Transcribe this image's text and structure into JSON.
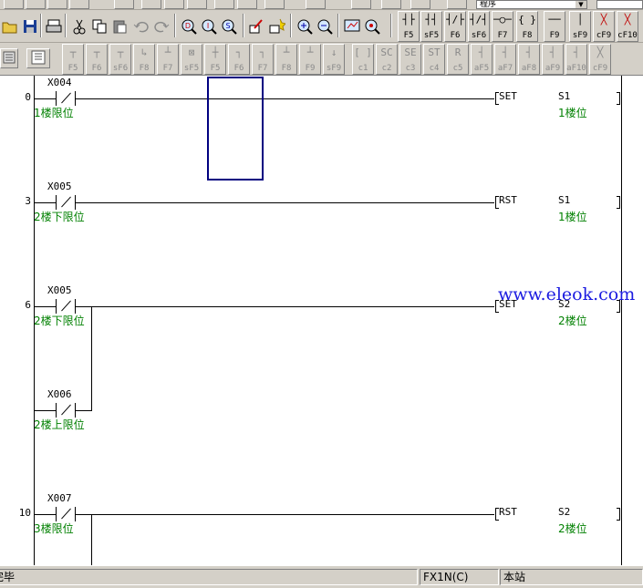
{
  "toolbar_top": {
    "program_combo_value": "程序"
  },
  "toolbar_main": {
    "ladder_keys": [
      {
        "key": "F5",
        "glyph": "┤├"
      },
      {
        "key": "sF5",
        "glyph": "┤┤"
      },
      {
        "key": "F6",
        "glyph": "┤/├"
      },
      {
        "key": "sF6",
        "glyph": "┤/┤"
      },
      {
        "key": "F7",
        "glyph": "─○─"
      },
      {
        "key": "F8",
        "glyph": "{ }"
      },
      {
        "key": "F9",
        "glyph": "──"
      },
      {
        "key": "sF9",
        "glyph": "│"
      },
      {
        "key": "cF9",
        "glyph": "╳"
      },
      {
        "key": "cF10",
        "glyph": "╳"
      }
    ]
  },
  "toolbar_secondary": {
    "ladder_keys": [
      {
        "key": "F5",
        "glyph": "┬"
      },
      {
        "key": "F6",
        "glyph": "┬"
      },
      {
        "key": "sF6",
        "glyph": "┬"
      },
      {
        "key": "F8",
        "glyph": "↳"
      },
      {
        "key": "F7",
        "glyph": "┴"
      },
      {
        "key": "sF5",
        "glyph": "⊠"
      },
      {
        "key": "F5",
        "glyph": "┼"
      },
      {
        "key": "F6",
        "glyph": "┐"
      },
      {
        "key": "F7",
        "glyph": "┐"
      },
      {
        "key": "F8",
        "glyph": "┴"
      },
      {
        "key": "F9",
        "glyph": "┴"
      },
      {
        "key": "sF9",
        "glyph": "↓"
      },
      {
        "key": "c1",
        "glyph": "[ ]"
      },
      {
        "key": "c2",
        "glyph": "SC"
      },
      {
        "key": "c3",
        "glyph": "SE"
      },
      {
        "key": "c4",
        "glyph": "ST"
      },
      {
        "key": "c5",
        "glyph": "R"
      },
      {
        "key": "aF5",
        "glyph": "┤"
      },
      {
        "key": "aF7",
        "glyph": "┤"
      },
      {
        "key": "aF8",
        "glyph": "┤"
      },
      {
        "key": "aF9",
        "glyph": "┤"
      },
      {
        "key": "aF10",
        "glyph": "┤"
      },
      {
        "key": "cF9",
        "glyph": "╳"
      }
    ]
  },
  "ladder": {
    "rungs": [
      {
        "step": "0",
        "contacts": [
          {
            "device": "X004",
            "comment": "1楼限位"
          }
        ],
        "instruction": "SET",
        "operand": "S1",
        "operand_comment": "1楼位"
      },
      {
        "step": "3",
        "contacts": [
          {
            "device": "X005",
            "comment": "2楼下限位"
          }
        ],
        "instruction": "RST",
        "operand": "S1",
        "operand_comment": "1楼位"
      },
      {
        "step": "6",
        "contacts": [
          {
            "device": "X005",
            "comment": "2楼下限位"
          },
          {
            "device": "X006",
            "comment": "2楼上限位"
          }
        ],
        "instruction": "SET",
        "operand": "S2",
        "operand_comment": "2楼位"
      },
      {
        "step": "10",
        "contacts": [
          {
            "device": "X007",
            "comment": "3楼限位"
          }
        ],
        "instruction": "RST",
        "operand": "S2",
        "operand_comment": "2楼位"
      }
    ]
  },
  "watermark": "www.eleok.com",
  "status_bar": {
    "left_text": "完毕",
    "plc_type": "FX1N(C)",
    "station": "本站"
  },
  "colors": {
    "comment": "#008000",
    "cursor": "#000080",
    "watermark": "#1b1be0",
    "chrome": "#d4d0c8"
  }
}
